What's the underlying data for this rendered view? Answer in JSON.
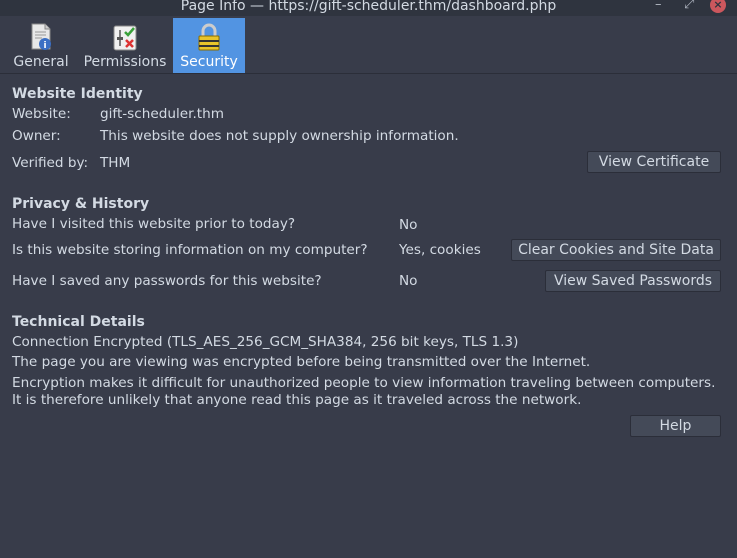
{
  "window": {
    "title": "Page Info — https://gift-scheduler.thm/dashboard.php",
    "minimize": "–",
    "maximize": "⤢",
    "close": "×"
  },
  "tabs": [
    {
      "label": "General",
      "icon": "page-info-icon",
      "active": false
    },
    {
      "label": "Permissions",
      "icon": "permissions-icon",
      "active": false
    },
    {
      "label": "Security",
      "icon": "padlock-icon",
      "active": true
    }
  ],
  "identity": {
    "heading": "Website Identity",
    "website_label": "Website:",
    "website_value": "gift-scheduler.thm",
    "owner_label": "Owner:",
    "owner_value": "This website does not supply ownership information.",
    "verified_label": "Verified by:",
    "verified_value": "THM",
    "view_cert_button": "View Certificate"
  },
  "privacy": {
    "heading": "Privacy & History",
    "q1": "Have I visited this website prior to today?",
    "a1": "No",
    "q2": "Is this website storing information on my computer?",
    "a2": "Yes, cookies",
    "clear_button": "Clear Cookies and Site Data",
    "q3": "Have I saved any passwords for this website?",
    "a3": "No",
    "passwords_button": "View Saved Passwords"
  },
  "technical": {
    "heading": "Technical Details",
    "line1": "Connection Encrypted (TLS_AES_256_GCM_SHA384, 256 bit keys, TLS 1.3)",
    "line2": "The page you are viewing was encrypted before being transmitted over the Internet.",
    "line3": "Encryption makes it difficult for unauthorized people to view information traveling between computers. It is therefore unlikely that anyone read this page as it traveled across the network."
  },
  "help_button": "Help",
  "colors": {
    "background": "#383c4a",
    "accent": "#5294e2",
    "close": "#cc575d"
  }
}
